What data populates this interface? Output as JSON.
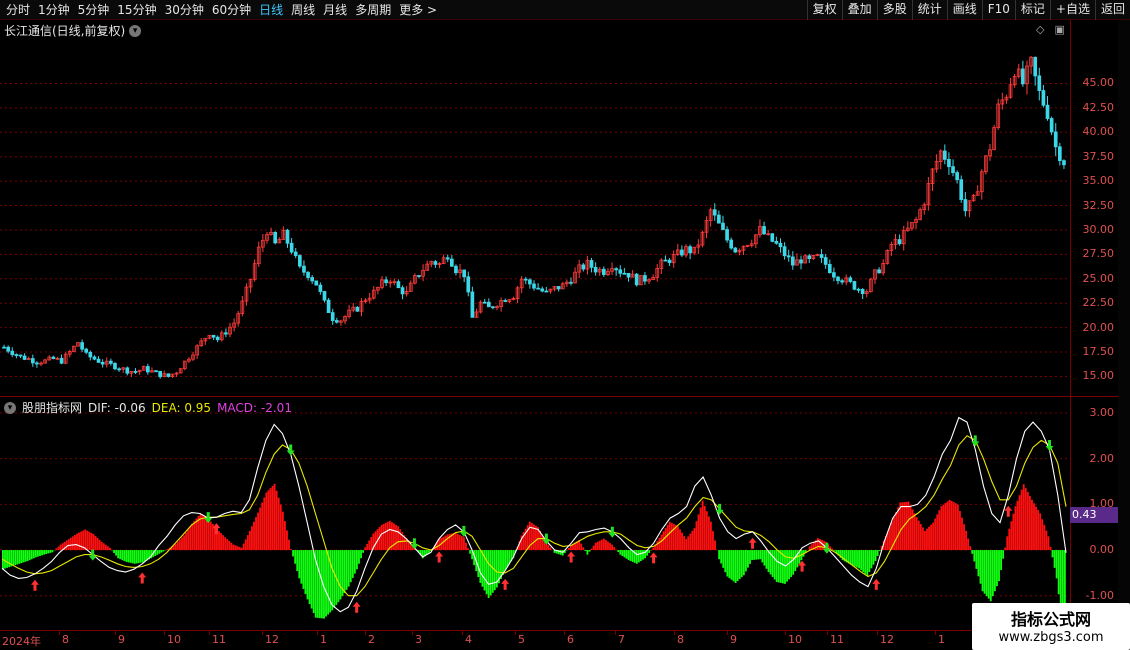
{
  "toolbar": {
    "period_tabs": [
      "分时",
      "1分钟",
      "5分钟",
      "15分钟",
      "30分钟",
      "60分钟",
      "日线",
      "周线",
      "月线",
      "多周期",
      "更多 >"
    ],
    "active_tab": "日线",
    "right_tools": [
      "复权",
      "叠加",
      "多股",
      "统计",
      "画线",
      "F10",
      "标记",
      "+自选",
      "返回"
    ]
  },
  "chart": {
    "title": "长江通信(日线,前复权)",
    "price_ticks": [
      "45.00",
      "42.50",
      "40.00",
      "37.50",
      "35.00",
      "32.50",
      "30.00",
      "27.50",
      "25.00",
      "22.50",
      "20.00",
      "17.50",
      "15.00"
    ],
    "time_labels": [
      "2024年",
      "8",
      "9",
      "10",
      "11",
      "12",
      "1",
      "2",
      "3",
      "4",
      "5",
      "6",
      "7",
      "8",
      "9",
      "10",
      "11",
      "12",
      "1"
    ]
  },
  "macd": {
    "indicator_name": "股朋指标网",
    "dif_text": "DIF: -0.06",
    "dea_text": "DEA: 0.95",
    "macd_text": "MACD: -2.01",
    "axis_ticks": [
      "3.00",
      "2.00",
      "1.00",
      "0.00",
      "-1.00"
    ],
    "current_value": "0.43"
  },
  "colors": {
    "up": "#ff3b3b",
    "down": "#3cd7e8",
    "macd_positive": "#ff1010",
    "macd_negative": "#10ff10",
    "dif_line": "#ffffff",
    "dea_line": "#e8e800",
    "grid": "#7a0000"
  },
  "icons": {
    "title_menu": "chevron-down-icon",
    "diamond": "diamond-icon",
    "window": "window-icon"
  },
  "chart_data": [
    {
      "type": "candlestick",
      "title": "长江通信(日线,前复权)",
      "ylim": [
        13.0,
        51.5
      ],
      "grid": true,
      "x_range": [
        "2024",
        "2025-01"
      ],
      "series": [
        {
          "name": "close_approx",
          "values": [
            18.0,
            17.5,
            17.0,
            16.8,
            16.5,
            16.6,
            16.8,
            16.6,
            17.5,
            18.5,
            17.2,
            16.8,
            16.4,
            16.2,
            15.9,
            15.6,
            15.5,
            15.8,
            15.5,
            15.2,
            15.0,
            15.5,
            16.5,
            17.5,
            18.5,
            19.5,
            18.8,
            19.6,
            20.5,
            22.5,
            25.0,
            28.0,
            30.0,
            28.5,
            29.5,
            28.0,
            26.0,
            25.5,
            24.5,
            22.5,
            21.0,
            20.8,
            21.5,
            22.0,
            23.0,
            23.6,
            24.5,
            25.0,
            24.0,
            23.5,
            25.0,
            26.0,
            26.8,
            26.5,
            27.5,
            26.0,
            25.5,
            21.0,
            22.5,
            22.0,
            22.5,
            23.0,
            23.3,
            25.0,
            24.5,
            24.0,
            23.5,
            24.0,
            24.3,
            25.0,
            26.0,
            26.5,
            26.0,
            25.8,
            26.5,
            25.8,
            25.5,
            24.8,
            25.0,
            25.5,
            26.5,
            27.0,
            27.5,
            28.0,
            27.8,
            29.5,
            32.0,
            30.5,
            29.0,
            28.0,
            28.5,
            29.0,
            30.0,
            29.2,
            28.5,
            27.5,
            26.5,
            27.0,
            26.8,
            27.2,
            26.5,
            25.5,
            25.0,
            24.5,
            24.0,
            23.8,
            25.5,
            26.5,
            28.5,
            29.0,
            30.0,
            31.0,
            33.0,
            36.0,
            38.0,
            37.0,
            35.0,
            32.0,
            33.0,
            36.0,
            38.5,
            42.5,
            44.0,
            46.5,
            45.0,
            47.0,
            44.0,
            42.0,
            38.5,
            37.0
          ]
        }
      ]
    },
    {
      "type": "bar",
      "title": "股朋指标网",
      "ylim": [
        -1.75,
        3.35
      ],
      "series": [
        {
          "name": "MACD",
          "values": [
            -0.42,
            -0.36,
            -0.3,
            -0.24,
            -0.16,
            -0.1,
            -0.05,
            0.12,
            0.24,
            0.36,
            0.45,
            0.35,
            0.18,
            0.05,
            -0.18,
            -0.26,
            -0.3,
            -0.27,
            -0.18,
            -0.08,
            0.02,
            0.14,
            0.32,
            0.58,
            0.8,
            0.68,
            0.46,
            0.28,
            0.12,
            0.05,
            0.42,
            0.82,
            1.26,
            1.45,
            0.84,
            0.02,
            -0.62,
            -1.08,
            -1.48,
            -1.5,
            -1.32,
            -1.08,
            -0.8,
            -0.42,
            0.06,
            0.36,
            0.55,
            0.64,
            0.52,
            0.26,
            0.08,
            -0.18,
            -0.02,
            0.24,
            0.34,
            0.38,
            0.28,
            -0.2,
            -0.72,
            -1.05,
            -0.82,
            -0.45,
            -0.18,
            0.32,
            0.62,
            0.5,
            0.18,
            -0.06,
            -0.12,
            0.1,
            0.22,
            -0.1,
            0.16,
            0.25,
            0.12,
            -0.1,
            -0.22,
            -0.3,
            -0.18,
            0.05,
            0.34,
            0.62,
            0.52,
            0.24,
            0.48,
            1.08,
            0.62,
            -0.2,
            -0.58,
            -0.72,
            -0.55,
            -0.22,
            -0.2,
            -0.48,
            -0.7,
            -0.74,
            -0.54,
            -0.22,
            0.08,
            0.26,
            0.18,
            -0.02,
            -0.22,
            -0.32,
            -0.4,
            -0.56,
            -0.24,
            0.2,
            0.62,
            1.04,
            1.06,
            0.72,
            0.42,
            0.6,
            0.96,
            1.1,
            1.0,
            0.42,
            -0.25,
            -0.9,
            -1.12,
            -0.68,
            0.3,
            0.96,
            1.44,
            1.1,
            0.8,
            0.3,
            -0.62,
            -2.01
          ]
        },
        {
          "name": "DIF",
          "values": [
            -0.4,
            -0.55,
            -0.62,
            -0.6,
            -0.52,
            -0.4,
            -0.25,
            -0.05,
            0.1,
            0.12,
            0.05,
            -0.1,
            -0.25,
            -0.38,
            -0.45,
            -0.48,
            -0.42,
            -0.3,
            -0.15,
            0.1,
            0.3,
            0.55,
            0.75,
            0.82,
            0.8,
            0.7,
            0.72,
            0.8,
            0.85,
            0.82,
            1.1,
            1.8,
            2.4,
            2.75,
            2.55,
            2.1,
            1.4,
            0.6,
            -0.2,
            -0.8,
            -1.2,
            -1.35,
            -1.25,
            -0.9,
            -0.4,
            0.05,
            0.35,
            0.45,
            0.4,
            0.25,
            0.05,
            -0.15,
            -0.05,
            0.25,
            0.45,
            0.55,
            0.4,
            0.0,
            -0.5,
            -0.75,
            -0.7,
            -0.45,
            -0.15,
            0.25,
            0.5,
            0.45,
            0.2,
            0.0,
            -0.05,
            0.15,
            0.38,
            0.4,
            0.45,
            0.48,
            0.4,
            0.25,
            0.05,
            -0.1,
            -0.05,
            0.15,
            0.45,
            0.7,
            0.8,
            0.95,
            1.4,
            1.6,
            1.2,
            0.7,
            0.4,
            0.25,
            0.35,
            0.4,
            0.2,
            -0.05,
            -0.25,
            -0.35,
            -0.2,
            0.05,
            0.15,
            0.2,
            0.05,
            -0.15,
            -0.35,
            -0.55,
            -0.7,
            -0.8,
            -0.4,
            0.2,
            0.7,
            0.95,
            0.95,
            1.0,
            1.2,
            1.6,
            2.1,
            2.4,
            2.9,
            2.8,
            2.2,
            1.4,
            0.8,
            0.6,
            1.2,
            2.0,
            2.6,
            2.8,
            2.6,
            2.2,
            1.2,
            -0.06
          ]
        },
        {
          "name": "DEA",
          "values": [
            -0.2,
            -0.3,
            -0.4,
            -0.48,
            -0.52,
            -0.5,
            -0.45,
            -0.35,
            -0.25,
            -0.15,
            -0.1,
            -0.1,
            -0.15,
            -0.22,
            -0.3,
            -0.36,
            -0.38,
            -0.36,
            -0.3,
            -0.2,
            -0.05,
            0.15,
            0.35,
            0.55,
            0.68,
            0.72,
            0.72,
            0.75,
            0.78,
            0.8,
            0.88,
            1.2,
            1.7,
            2.1,
            2.3,
            2.2,
            1.9,
            1.4,
            0.8,
            0.2,
            -0.4,
            -0.8,
            -1.0,
            -1.0,
            -0.8,
            -0.5,
            -0.2,
            0.05,
            0.18,
            0.2,
            0.15,
            0.05,
            0.0,
            0.1,
            0.25,
            0.38,
            0.42,
            0.3,
            0.0,
            -0.3,
            -0.48,
            -0.5,
            -0.4,
            -0.15,
            0.1,
            0.25,
            0.25,
            0.15,
            0.08,
            0.1,
            0.2,
            0.3,
            0.36,
            0.4,
            0.4,
            0.35,
            0.22,
            0.1,
            0.05,
            0.08,
            0.2,
            0.38,
            0.55,
            0.7,
            0.95,
            1.15,
            1.1,
            0.9,
            0.7,
            0.5,
            0.42,
            0.4,
            0.32,
            0.18,
            0.0,
            -0.15,
            -0.18,
            -0.1,
            0.0,
            0.08,
            0.05,
            -0.05,
            -0.18,
            -0.32,
            -0.46,
            -0.58,
            -0.5,
            -0.25,
            0.1,
            0.45,
            0.68,
            0.8,
            0.95,
            1.2,
            1.55,
            1.85,
            2.3,
            2.5,
            2.4,
            2.0,
            1.5,
            1.1,
            1.1,
            1.4,
            1.9,
            2.25,
            2.4,
            2.3,
            1.9,
            0.95
          ]
        }
      ]
    }
  ]
}
